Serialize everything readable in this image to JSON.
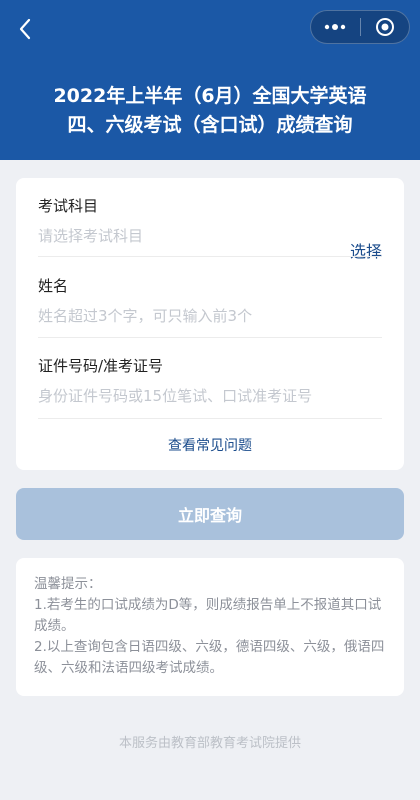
{
  "header": {
    "title_line1": "2022年上半年（6月）全国大学英语",
    "title_line2": "四、六级考试（含口试）成绩查询",
    "more_icon": "more-dots-icon",
    "close_icon": "target-circle-icon",
    "back_icon": "chevron-left-icon"
  },
  "form": {
    "subject": {
      "label": "考试科目",
      "placeholder": "请选择考试科目",
      "action": "选择"
    },
    "name": {
      "label": "姓名",
      "placeholder": "姓名超过3个字，可只输入前3个"
    },
    "id": {
      "label": "证件号码/准考证号",
      "placeholder": "身份证件号码或15位笔试、口试准考证号"
    },
    "faq": "查看常见问题"
  },
  "submit_label": "立即查询",
  "tips": {
    "heading": "温馨提示：",
    "item1": "1.若考生的口试成绩为D等，则成绩报告单上不报道其口试成绩。",
    "item2": "2.以上查询包含日语四级、六级，德语四级、六级，俄语四级、六级和法语四级考试成绩。"
  },
  "footer": "本服务由教育部教育考试院提供",
  "colors": {
    "header_bg": "#1b58a6",
    "link": "#1b4c8c",
    "button_disabled": "#a9c1dc",
    "page_bg": "#eef0f4"
  }
}
